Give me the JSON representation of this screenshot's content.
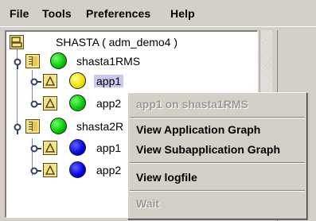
{
  "menubar": {
    "file": "File",
    "tools": "Tools",
    "preferences": "Preferences",
    "help": "Help"
  },
  "tree": {
    "root_label": "SHASTA ( adm_demo4 )",
    "host1": {
      "label": "shasta1RMS",
      "status_color": "#00c800",
      "apps": [
        {
          "label": "app1",
          "status_color": "#f0e000"
        },
        {
          "label": "app2",
          "status_color": "#00c800"
        }
      ]
    },
    "host2": {
      "label": "shasta2R",
      "status_color": "#00c800",
      "apps": [
        {
          "label": "app1",
          "status_color": "#0000e0"
        },
        {
          "label": "app2",
          "status_color": "#0000e0"
        }
      ]
    }
  },
  "context_menu": {
    "header": "app1 on shasta1RMS",
    "view_app_graph": "View Application Graph",
    "view_subapp_graph": "View Subapplication Graph",
    "view_logfile": "View logfile",
    "wait": "Wait"
  }
}
